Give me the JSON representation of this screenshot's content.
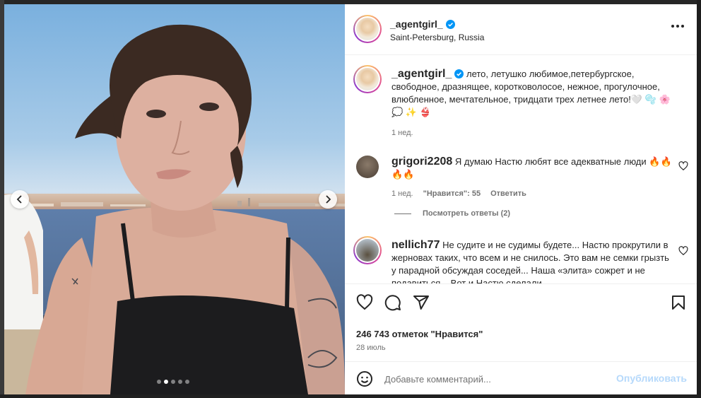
{
  "post": {
    "username": "_agentgirl_",
    "verified": true,
    "location": "Saint-Petersburg, Russia",
    "carousel": {
      "total": 5,
      "active": 1
    }
  },
  "caption": {
    "username": "_agentgirl_",
    "text": "лето, летушко любимое,петербургское, свободное, дразнящее, коротковолосое, нежное, прогулочное, влюбленное, мечтательное, тридцати трех летнее лето!🤍 🫧 🌸 💭 ✨ 👙",
    "time": "1 нед."
  },
  "comments": [
    {
      "username": "grigori2208",
      "text": "Я думаю Настю любят все адекватные люди 🔥🔥🔥🔥",
      "time": "1 нед.",
      "likes": "\"Нравится\": 55",
      "reply_label": "Ответить",
      "view_replies": "Посмотреть ответы (2)"
    },
    {
      "username": "nellich77",
      "text": "Не судите и не судимы будете... Настю прокрутили в жерновах таких, что всем и не снилось. Это вам не семки грызть у парадной обсуждая соседей... Наша «элита» сожрет и не подавиться... Вот и Настю сделали"
    }
  ],
  "actions": {
    "likes_text": "246 743 отметок \"Нравится\"",
    "date": "28 июль"
  },
  "comment_box": {
    "placeholder": "Добавьте комментарий...",
    "publish_label": "Опубликовать"
  },
  "colors": {
    "accent": "#0095f6",
    "publish_disabled": "#b6d9fb",
    "text_primary": "#262626",
    "text_secondary": "#737373"
  },
  "icons": [
    "more-icon",
    "verified-icon",
    "heart-icon",
    "comment-icon",
    "share-icon",
    "bookmark-icon",
    "emoji-icon",
    "chevron-left-icon",
    "chevron-right-icon"
  ]
}
